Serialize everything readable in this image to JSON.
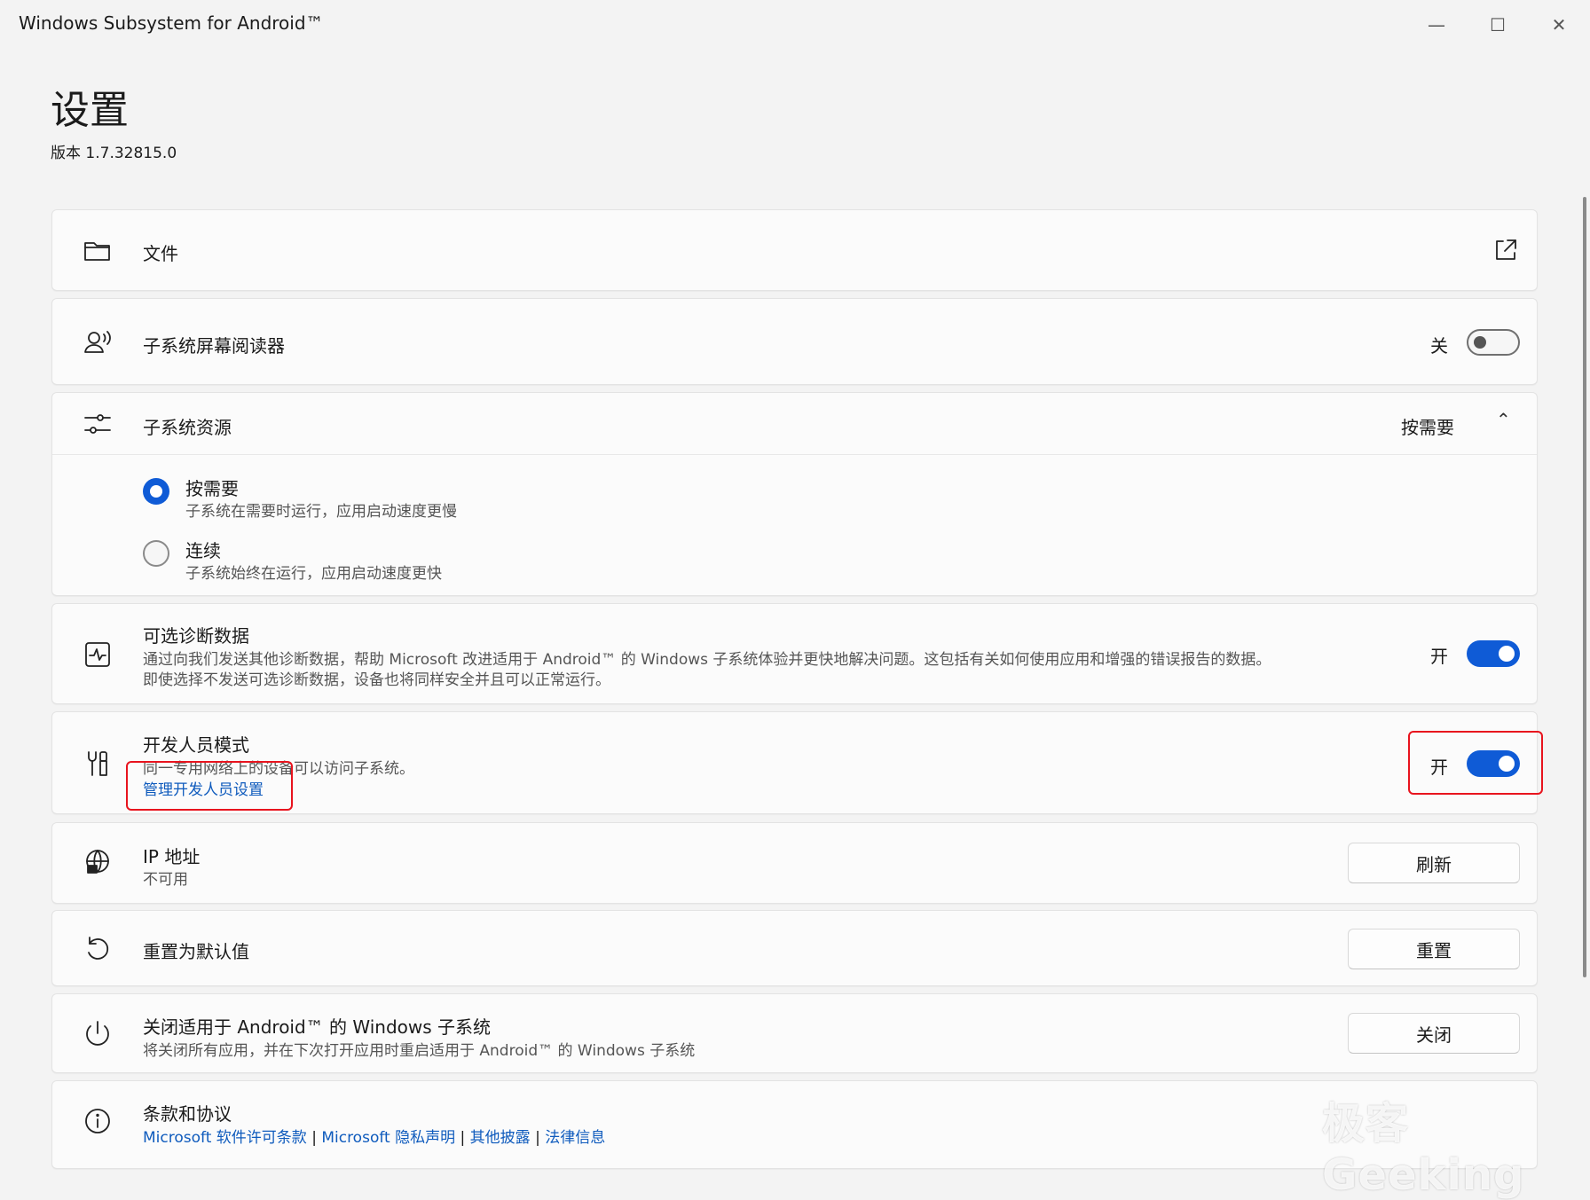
{
  "window": {
    "title": "Windows Subsystem for Android™",
    "minimize": "—",
    "maximize": "☐",
    "close": "✕"
  },
  "page": {
    "title": "设置",
    "version": "版本 1.7.32815.0"
  },
  "files": {
    "label": "文件"
  },
  "screen_reader": {
    "label": "子系统屏幕阅读器",
    "state": "关",
    "on": false
  },
  "resources": {
    "label": "子系统资源",
    "value": "按需要",
    "options": [
      {
        "title": "按需要",
        "desc": "子系统在需要时运行，应用启动速度更慢",
        "selected": true
      },
      {
        "title": "连续",
        "desc": "子系统始终在运行，应用启动速度更快",
        "selected": false
      }
    ]
  },
  "diagnostics": {
    "label": "可选诊断数据",
    "desc1": "通过向我们发送其他诊断数据，帮助 Microsoft 改进适用于 Android™ 的 Windows 子系统体验并更快地解决问题。这包括有关如何使用应用和增强的错误报告的数据。",
    "desc2": "即使选择不发送可选诊断数据，设备也将同样安全并且可以正常运行。",
    "state": "开",
    "on": true
  },
  "developer": {
    "label": "开发人员模式",
    "desc": "同一专用网络上的设备可以访问子系统。",
    "link": "管理开发人员设置",
    "state": "开",
    "on": true
  },
  "ip": {
    "label": "IP 地址",
    "value": "不可用",
    "button": "刷新"
  },
  "reset": {
    "label": "重置为默认值",
    "button": "重置"
  },
  "shutdown": {
    "label": "关闭适用于 Android™ 的 Windows 子系统",
    "desc": "将关闭所有应用，并在下次打开应用时重启适用于 Android™ 的 Windows 子系统",
    "button": "关闭"
  },
  "terms": {
    "label": "条款和协议",
    "links": [
      "Microsoft 软件许可条款",
      "Microsoft 隐私声明",
      "其他披露",
      "法律信息"
    ],
    "separator": "|"
  },
  "watermark": "极客Geeking",
  "colors": {
    "accent": "#0f5bd6",
    "link": "#0f5bbd",
    "highlight": "#e8141e"
  }
}
